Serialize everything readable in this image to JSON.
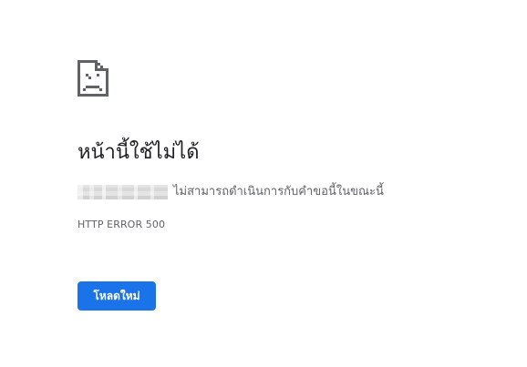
{
  "error": {
    "icon": "sad-page-icon",
    "title": "หน้านี้ใช้ไม่ได้",
    "detail": "ไม่สามารถดำเนินการกับคำขอนี้ในขณะนี้",
    "code": "HTTP ERROR 500",
    "reload_label": "โหลดใหม่"
  },
  "colors": {
    "accent": "#1a73e8",
    "title_text": "#202124",
    "secondary_text": "#5f6368",
    "icon_stroke": "#5f6368"
  }
}
